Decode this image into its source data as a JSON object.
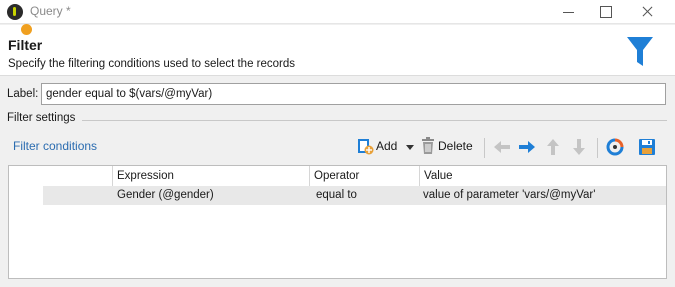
{
  "window": {
    "title": "Query *"
  },
  "header": {
    "title": "Filter",
    "subtitle": "Specify the filtering conditions used to select the records"
  },
  "label": {
    "caption": "Label:",
    "value": "gender equal to $(vars/@myVar)"
  },
  "settings": {
    "caption": "Filter settings"
  },
  "toolbar": {
    "filter_conditions_label": "Filter conditions",
    "add_label": "Add",
    "delete_label": "Delete"
  },
  "table": {
    "columns": [
      "",
      "Expression",
      "Operator",
      "Value"
    ],
    "rows": [
      {
        "status_color": "#f0a020",
        "expression": "Gender (@gender)",
        "operator": "equal to",
        "value": "value of parameter 'vars/@myVar'"
      }
    ]
  },
  "colors": {
    "accent_blue": "#1f7fd6",
    "link_blue": "#2b6cb0",
    "status_orange": "#f0a020"
  },
  "icons": [
    "app-icon",
    "funnel-icon",
    "add-icon",
    "delete-icon",
    "arrow-left-icon",
    "arrow-right-icon",
    "arrow-up-icon",
    "arrow-down-icon",
    "refresh-icon",
    "save-icon"
  ]
}
